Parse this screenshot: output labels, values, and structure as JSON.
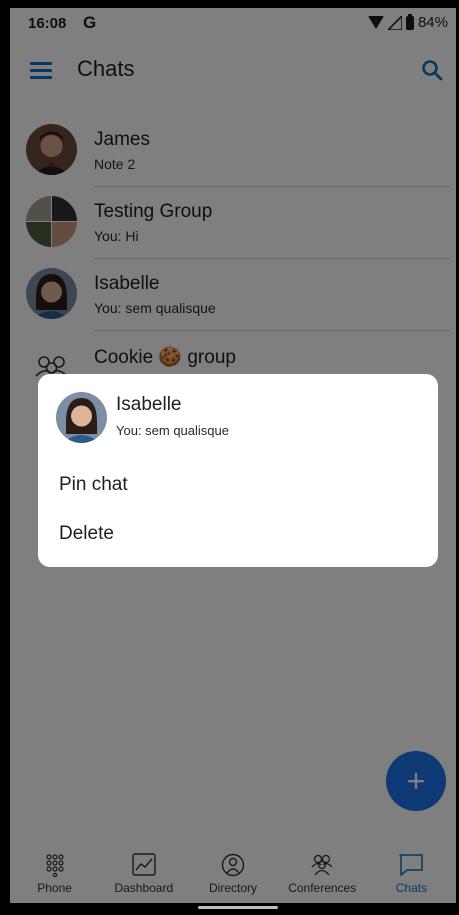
{
  "status_bar": {
    "time": "16:08",
    "app_glyph": "G",
    "battery": "84%"
  },
  "app_bar": {
    "title": "Chats",
    "menu_icon": "hamburger-menu-icon",
    "search_icon": "search-icon"
  },
  "chats": [
    {
      "name": "James",
      "preview": "Note 2"
    },
    {
      "name": "Testing Group",
      "preview": "You: Hi"
    },
    {
      "name": "Isabelle",
      "preview": "You: sem qualisque"
    },
    {
      "name": "Cookie 🍪 group",
      "preview": ""
    }
  ],
  "dialog": {
    "name": "Isabelle",
    "preview": "You: sem qualisque",
    "actions": [
      "Pin chat",
      "Delete"
    ]
  },
  "fab": {
    "label": "+"
  },
  "bottom_nav": {
    "items": [
      {
        "label": "Phone",
        "icon": "dialpad-icon"
      },
      {
        "label": "Dashboard",
        "icon": "chart-icon"
      },
      {
        "label": "Directory",
        "icon": "directory-icon"
      },
      {
        "label": "Conferences",
        "icon": "conferences-icon"
      },
      {
        "label": "Chats",
        "icon": "chat-bubble-icon"
      }
    ],
    "active": "Chats"
  },
  "colors": {
    "accent": "#0a72c4",
    "fab": "#1a73e8",
    "scrim": "rgba(0,0,0,0.5)"
  }
}
